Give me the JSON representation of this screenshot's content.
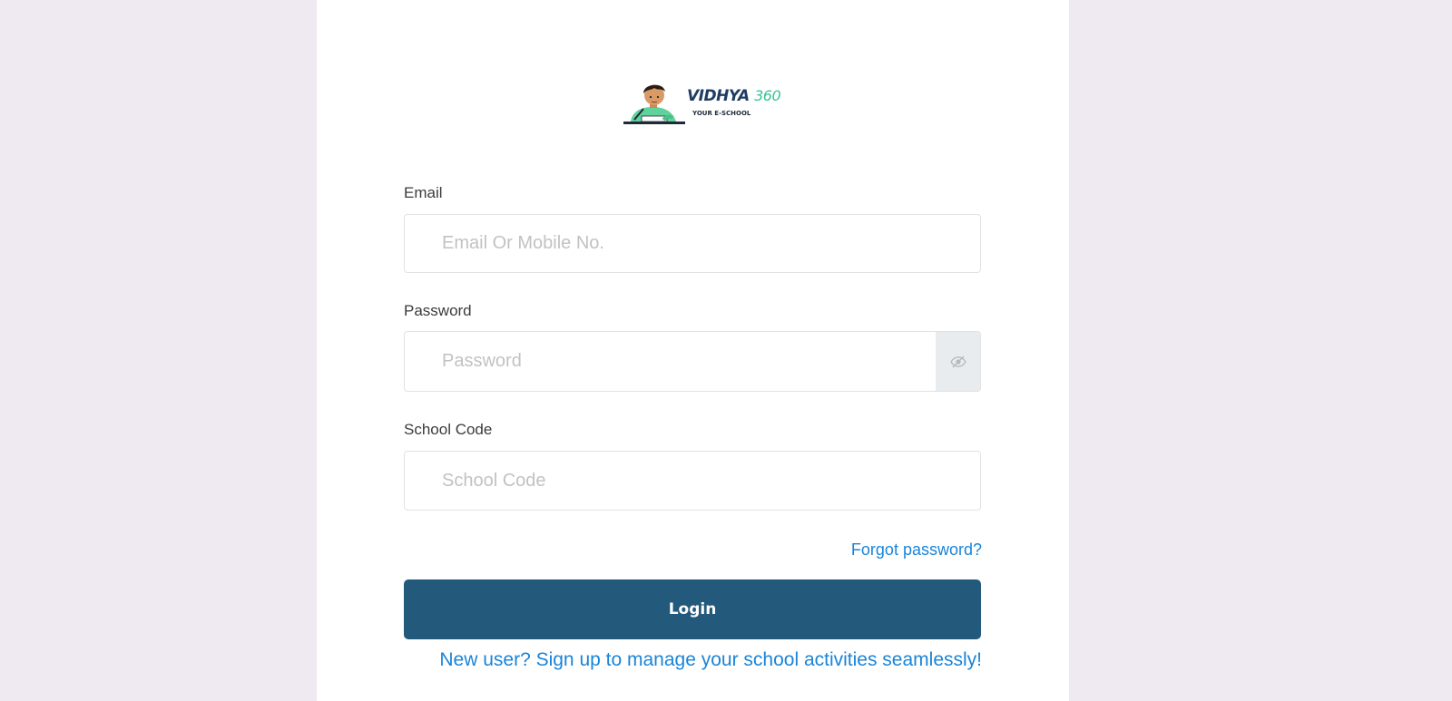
{
  "logo": {
    "brand": "VIDHYA",
    "brand_number": "360",
    "tagline": "YOUR E-SCHOOL",
    "colors": {
      "navy": "#1f3d63",
      "green": "#37c29a"
    }
  },
  "form": {
    "email": {
      "label": "Email",
      "placeholder": "Email Or Mobile No.",
      "value": ""
    },
    "password": {
      "label": "Password",
      "placeholder": "Password",
      "value": "",
      "toggle_icon": "eye-slash-icon"
    },
    "school_code": {
      "label": "School Code",
      "placeholder": "School Code",
      "value": ""
    },
    "forgot_link": "Forgot password?",
    "login_button": "Login",
    "signup_link": "New user? Sign up to manage your school activities seamlessly!"
  },
  "colors": {
    "background": "#efe9f1",
    "card": "#ffffff",
    "primary_button": "#23597b",
    "link": "#1a84d8"
  }
}
